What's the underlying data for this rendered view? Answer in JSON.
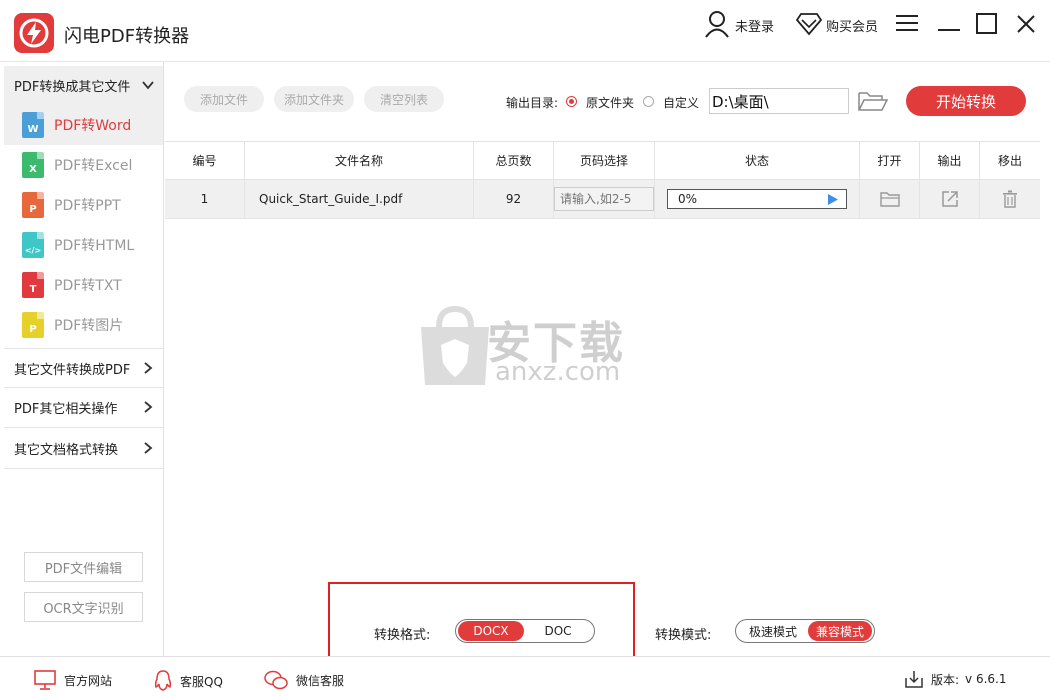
{
  "titlebar": {
    "app_title": "闪电PDF转换器",
    "login_label": "未登录",
    "buy_label": "购买会员",
    "brand_color": "#e23b3b"
  },
  "sidebar": {
    "categories": [
      {
        "label": "PDF转换成其它文件",
        "expanded": true
      },
      {
        "label": "其它文件转换成PDF",
        "expanded": false
      },
      {
        "label": "PDF其它相关操作",
        "expanded": false
      },
      {
        "label": "其它文档格式转换",
        "expanded": false
      }
    ],
    "items": [
      {
        "label": "PDF转Word",
        "icon": "W",
        "color": "#4a9fd8",
        "active": true
      },
      {
        "label": "PDF转Excel",
        "icon": "X",
        "color": "#3cba6e",
        "active": false
      },
      {
        "label": "PDF转PPT",
        "icon": "P",
        "color": "#e8683d",
        "active": false
      },
      {
        "label": "PDF转HTML",
        "icon": "</>",
        "color": "#3ec7c7",
        "active": false
      },
      {
        "label": "PDF转TXT",
        "icon": "T",
        "color": "#e0393e",
        "active": false
      },
      {
        "label": "PDF转图片",
        "icon": "P",
        "color": "#e6d02a",
        "active": false
      }
    ],
    "edit_button": "PDF文件编辑",
    "ocr_button": "OCR文字识别"
  },
  "toolbar": {
    "add_file": "添加文件",
    "add_folder": "添加文件夹",
    "clear_list": "清空列表",
    "output_label": "输出目录:",
    "option_original": "原文件夹",
    "option_custom": "自定义",
    "path_value": "D:\\桌面\\",
    "start_button": "开始转换"
  },
  "table": {
    "headers": [
      "编号",
      "文件名称",
      "总页数",
      "页码选择",
      "状态",
      "打开",
      "输出",
      "移出"
    ],
    "rows": [
      {
        "index": "1",
        "filename": "Quick_Start_Guide_I.pdf",
        "pages": "92",
        "page_placeholder": "请输入,如2-5",
        "progress_text": "0%",
        "progress": 0
      }
    ]
  },
  "watermark": {
    "title": "安下载",
    "url": "anxz.com"
  },
  "format": {
    "format_label": "转换格式:",
    "format_options": [
      "DOCX",
      "DOC"
    ],
    "format_selected": "DOCX",
    "mode_label": "转换模式:",
    "mode_options": [
      "极速模式",
      "兼容模式"
    ],
    "mode_selected": "兼容模式"
  },
  "statusbar": {
    "website": "官方网站",
    "qq": "客服QQ",
    "wechat": "微信客服",
    "version_label": "版本:",
    "version": "v 6.6.1"
  }
}
